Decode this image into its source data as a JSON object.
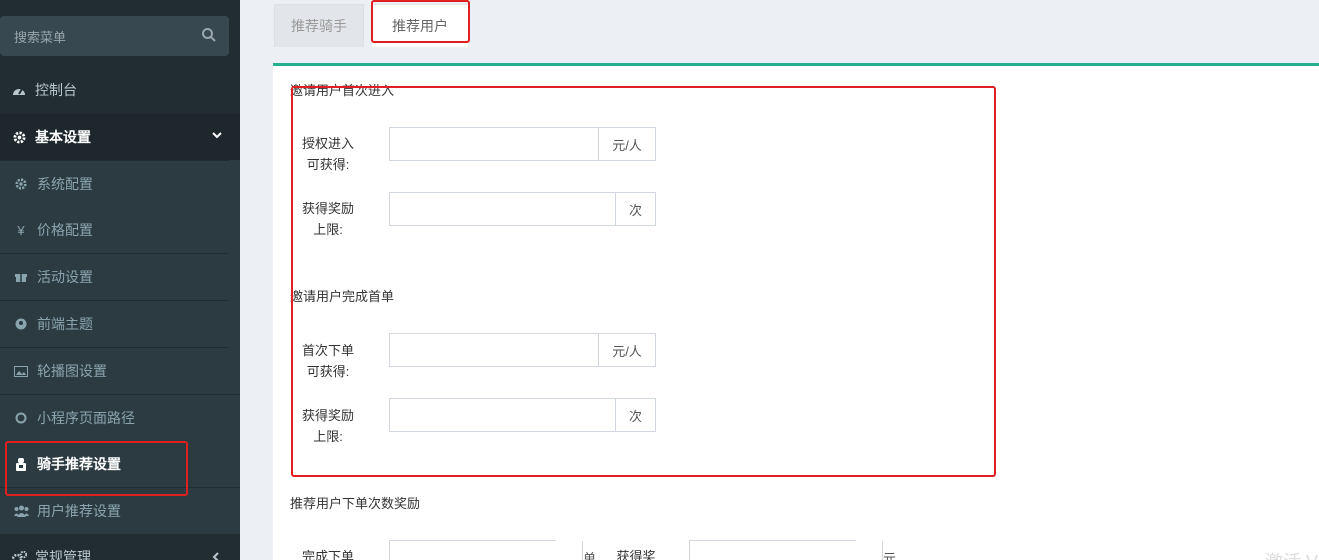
{
  "sidebar": {
    "search_placeholder": "搜索菜单",
    "items": [
      {
        "label": "控制台",
        "icon": "dashboard-icon"
      },
      {
        "label": "基本设置",
        "icon": "gear-icon"
      },
      {
        "label": "系统配置",
        "icon": "gear-icon"
      },
      {
        "label": "价格配置",
        "icon": "yen-icon"
      },
      {
        "label": "活动设置",
        "icon": "gift-icon"
      },
      {
        "label": "前端主题",
        "icon": "theme-icon"
      },
      {
        "label": "轮播图设置",
        "icon": "image-icon"
      },
      {
        "label": "小程序页面路径",
        "icon": "circle-icon"
      },
      {
        "label": "骑手推荐设置",
        "icon": "rider-icon"
      },
      {
        "label": "用户推荐设置",
        "icon": "users-icon"
      },
      {
        "label": "常规管理",
        "icon": "cogs-icon"
      }
    ]
  },
  "tabs": [
    "推荐骑手",
    "推荐用户"
  ],
  "sections": [
    {
      "title": "邀请用户首次进入",
      "fields": [
        {
          "label_line1": "授权进入",
          "label_line2": "可获得:",
          "value": "",
          "unit": "元/人"
        },
        {
          "label_line1": "获得奖励",
          "label_line2": "上限:",
          "value": "",
          "unit": "次"
        }
      ]
    },
    {
      "title": "邀请用户完成首单",
      "fields": [
        {
          "label_line1": "首次下单",
          "label_line2": "可获得:",
          "value": "",
          "unit": "元/人"
        },
        {
          "label_line1": "获得奖励",
          "label_line2": "上限:",
          "value": "",
          "unit": "次"
        }
      ]
    },
    {
      "title": "推荐用户下单次数奖励",
      "fields": [
        {
          "label_line1": "完成下单",
          "value": "",
          "unit": "单"
        },
        {
          "label_line1": "获得奖",
          "value": "",
          "unit": "元"
        }
      ]
    }
  ],
  "watermark": "激活 V",
  "colors": {
    "sidebar_bg": "#222d32",
    "accent": "#27b08f",
    "highlight": "#e02020"
  }
}
